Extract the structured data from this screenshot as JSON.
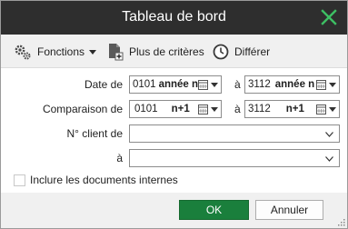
{
  "window": {
    "title": "Tableau de bord"
  },
  "toolbar": {
    "functions_label": "Fonctions",
    "more_criteria_label": "Plus de critères",
    "defer_label": "Différer"
  },
  "form": {
    "date_label": "Date de",
    "date_from_day": "0101",
    "date_from_year": "année n",
    "to_label_1": "à",
    "date_to_day": "3112",
    "date_to_year": "année n",
    "comparison_label": "Comparaison de",
    "comp_from_day": "0101",
    "comp_from_year": "n+1",
    "to_label_2": "à",
    "comp_to_day": "3112",
    "comp_to_year": "n+1",
    "client_from_label": "N° client de",
    "client_from_value": "",
    "client_to_label": "à",
    "client_to_value": "",
    "include_internal_label": "Inclure les documents internes"
  },
  "buttons": {
    "ok": "OK",
    "cancel": "Annuler"
  },
  "colors": {
    "titlebar": "#2e2e2e",
    "accent_green": "#1a7f3c",
    "close_icon": "#3dbf63"
  }
}
